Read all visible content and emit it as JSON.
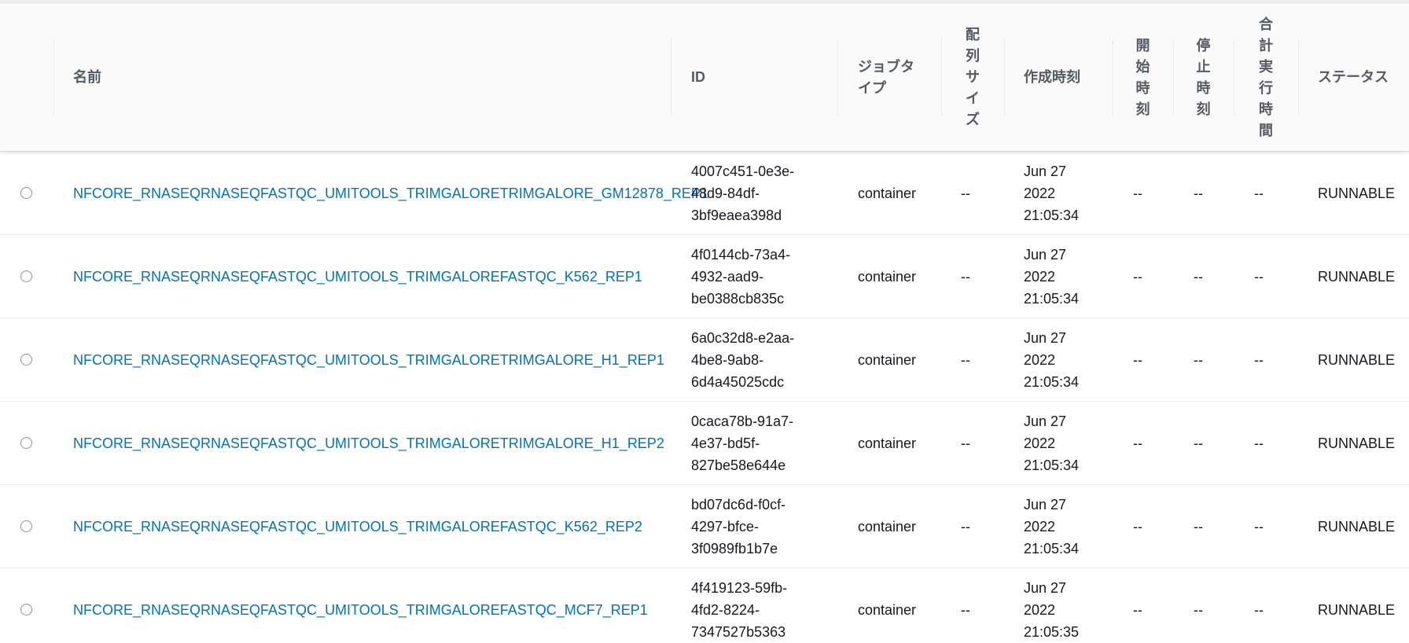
{
  "table": {
    "headers": {
      "name": "名前",
      "id": "ID",
      "job_type": "ジョブタイプ",
      "array_size": "配列サイズ",
      "created": "作成時刻",
      "started": "開始時刻",
      "stopped": "停止時刻",
      "total_runtime": "合計実行時間",
      "status": "ステータス"
    },
    "header_lines": {
      "job_type": [
        "ジョブタ",
        "イプ"
      ],
      "array_size": [
        "配",
        "列",
        "サ",
        "イ",
        "ズ"
      ],
      "started": [
        "開",
        "始",
        "時",
        "刻"
      ],
      "stopped": [
        "停",
        "止",
        "時",
        "刻"
      ],
      "total_runtime": [
        "合",
        "計",
        "実",
        "行",
        "時",
        "間"
      ]
    },
    "rows": [
      {
        "name": "NFCORE_RNASEQRNASEQFASTQC_UMITOOLS_TRIMGALORETRIMGALORE_GM12878_REP1",
        "id": "4007c451-0e3e-\n48d9-84df-\n3bf9eaea398d",
        "job_type": "container",
        "array_size": "--",
        "created": "Jun 27\n2022\n21:05:34",
        "started": "--",
        "stopped": "--",
        "total_runtime": "--",
        "status": "RUNNABLE"
      },
      {
        "name": "NFCORE_RNASEQRNASEQFASTQC_UMITOOLS_TRIMGALOREFASTQC_K562_REP1",
        "id": "4f0144cb-73a4-\n4932-aad9-\nbe0388cb835c",
        "job_type": "container",
        "array_size": "--",
        "created": "Jun 27\n2022\n21:05:34",
        "started": "--",
        "stopped": "--",
        "total_runtime": "--",
        "status": "RUNNABLE"
      },
      {
        "name": "NFCORE_RNASEQRNASEQFASTQC_UMITOOLS_TRIMGALORETRIMGALORE_H1_REP1",
        "id": "6a0c32d8-e2aa-\n4be8-9ab8-\n6d4a45025cdc",
        "job_type": "container",
        "array_size": "--",
        "created": "Jun 27\n2022\n21:05:34",
        "started": "--",
        "stopped": "--",
        "total_runtime": "--",
        "status": "RUNNABLE"
      },
      {
        "name": "NFCORE_RNASEQRNASEQFASTQC_UMITOOLS_TRIMGALORETRIMGALORE_H1_REP2",
        "id": "0caca78b-91a7-\n4e37-bd5f-\n827be58e644e",
        "job_type": "container",
        "array_size": "--",
        "created": "Jun 27\n2022\n21:05:34",
        "started": "--",
        "stopped": "--",
        "total_runtime": "--",
        "status": "RUNNABLE"
      },
      {
        "name": "NFCORE_RNASEQRNASEQFASTQC_UMITOOLS_TRIMGALOREFASTQC_K562_REP2",
        "id": "bd07dc6d-f0cf-\n4297-bfce-\n3f0989fb1b7e",
        "job_type": "container",
        "array_size": "--",
        "created": "Jun 27\n2022\n21:05:34",
        "started": "--",
        "stopped": "--",
        "total_runtime": "--",
        "status": "RUNNABLE"
      },
      {
        "name": "NFCORE_RNASEQRNASEQFASTQC_UMITOOLS_TRIMGALOREFASTQC_MCF7_REP1",
        "id": "4f419123-59fb-\n4fd2-8224-\n7347527b5363",
        "job_type": "container",
        "array_size": "--",
        "created": "Jun 27\n2022\n21:05:35",
        "started": "--",
        "stopped": "--",
        "total_runtime": "--",
        "status": "RUNNABLE"
      }
    ]
  },
  "colors": {
    "link": "#0073bb",
    "header_bg": "#fafafa",
    "header_text": "#545b64",
    "border": "#eaeded"
  }
}
